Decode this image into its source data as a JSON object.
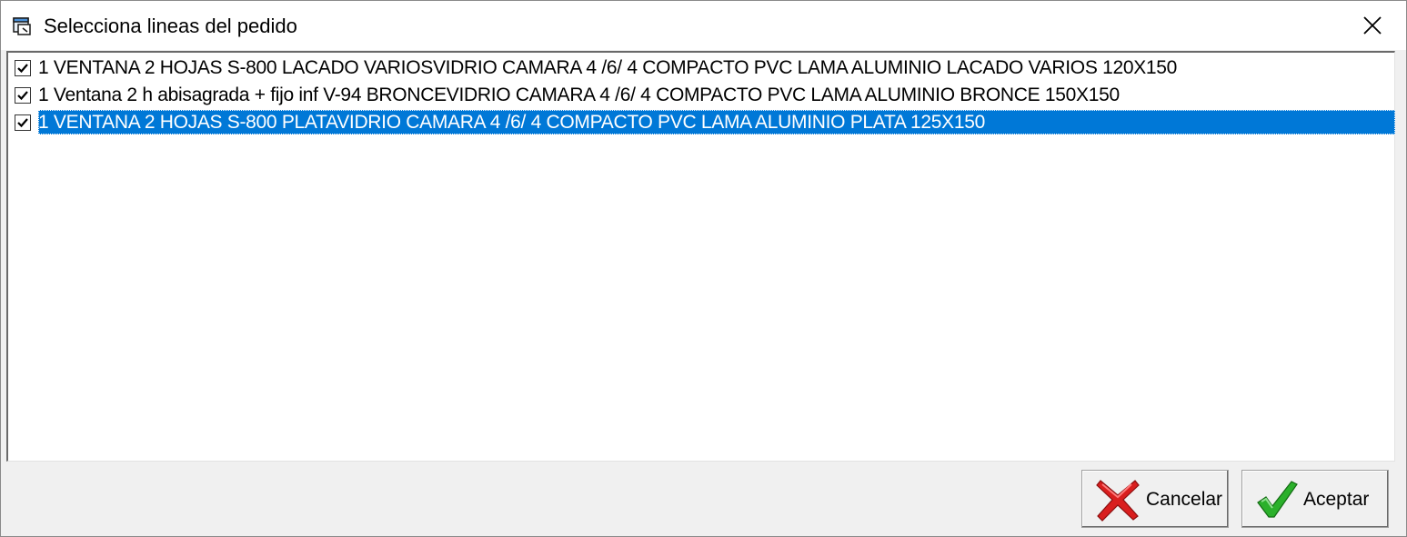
{
  "window": {
    "title": "Selecciona lineas del pedido",
    "icon": "window-app-icon",
    "close_icon": "close-icon"
  },
  "list": {
    "items": [
      {
        "checked": true,
        "selected": false,
        "label": "1 VENTANA 2 HOJAS S-800 LACADO VARIOSVIDRIO CAMARA 4 /6/ 4 COMPACTO PVC LAMA ALUMINIO LACADO VARIOS 120X150"
      },
      {
        "checked": true,
        "selected": false,
        "label": "1 Ventana 2 h abisagrada + fijo inf V-94 BRONCEVIDRIO CAMARA 4 /6/ 4 COMPACTO PVC LAMA ALUMINIO BRONCE 150X150"
      },
      {
        "checked": true,
        "selected": true,
        "label": "1 VENTANA 2 HOJAS S-800 PLATAVIDRIO CAMARA 4 /6/ 4 COMPACTO PVC LAMA ALUMINIO PLATA 125X150"
      }
    ],
    "selection_color": "#0078d7"
  },
  "buttons": {
    "cancel": {
      "label": "Cancelar",
      "icon": "red-x-icon",
      "icon_color": "#d91e1e"
    },
    "accept": {
      "label": "Aceptar",
      "icon": "green-check-icon",
      "icon_color": "#2bb02b"
    }
  }
}
